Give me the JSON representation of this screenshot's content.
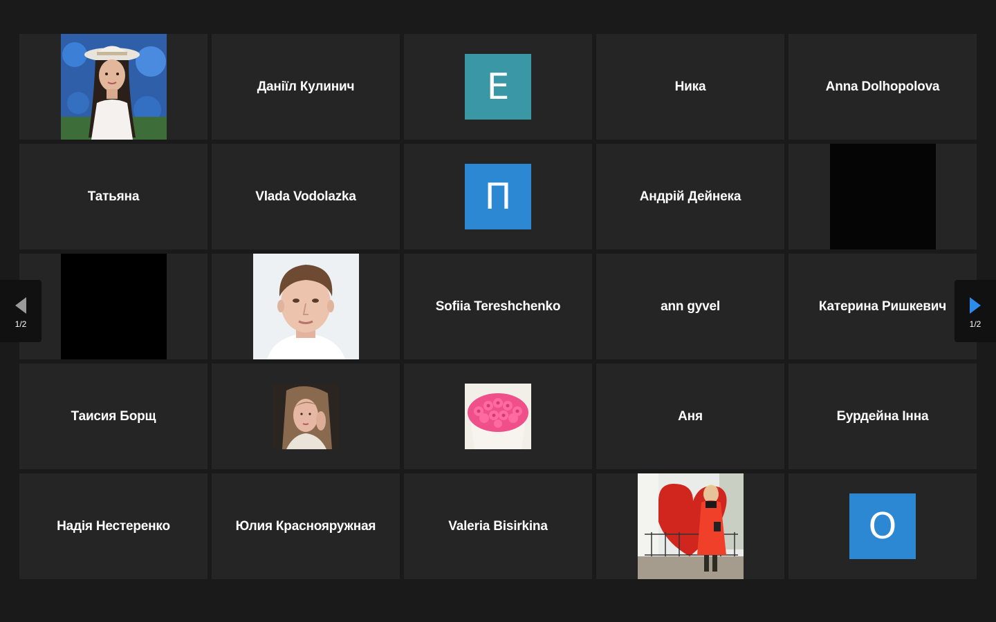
{
  "participants": [
    {
      "type": "photo",
      "photo": "girl-hat-flowers"
    },
    {
      "type": "name",
      "name": "Даніїл Кулинич"
    },
    {
      "type": "initial",
      "initial": "E",
      "color": "#3a97a6"
    },
    {
      "type": "name",
      "name": "Ника"
    },
    {
      "type": "name",
      "name": "Anna Dolhopolova"
    },
    {
      "type": "name",
      "name": "Татьяна"
    },
    {
      "type": "name",
      "name": "Vlada Vodolazka"
    },
    {
      "type": "initial",
      "initial": "П",
      "color": "#2d88d4"
    },
    {
      "type": "name",
      "name": "Андрій Дейнека"
    },
    {
      "type": "photo",
      "photo": "dark"
    },
    {
      "type": "photo",
      "photo": "black"
    },
    {
      "type": "photo",
      "photo": "boy-portrait"
    },
    {
      "type": "name",
      "name": "Sofiia Tereshchenko"
    },
    {
      "type": "name",
      "name": "ann gyvel"
    },
    {
      "type": "name",
      "name": "Катерина Ришкевич"
    },
    {
      "type": "name",
      "name": "Таисия Борщ"
    },
    {
      "type": "photo",
      "photo": "girl-selfie"
    },
    {
      "type": "photo",
      "photo": "pink-roses"
    },
    {
      "type": "name",
      "name": "Аня"
    },
    {
      "type": "name",
      "name": "Бурдейна Інна"
    },
    {
      "type": "name",
      "name": "Надія Нестеренко"
    },
    {
      "type": "name",
      "name": "Юлия Краснояружная"
    },
    {
      "type": "name",
      "name": "Valeria Bisirkina"
    },
    {
      "type": "photo",
      "photo": "woman-red-heart"
    },
    {
      "type": "initial",
      "initial": "O",
      "color": "#2d88d4"
    }
  ],
  "pager": {
    "prev_page": "1/2",
    "next_page": "1/2",
    "prev_icon": "chevron-left-icon",
    "next_icon": "chevron-right-icon",
    "next_color": "#2d8ceb"
  }
}
